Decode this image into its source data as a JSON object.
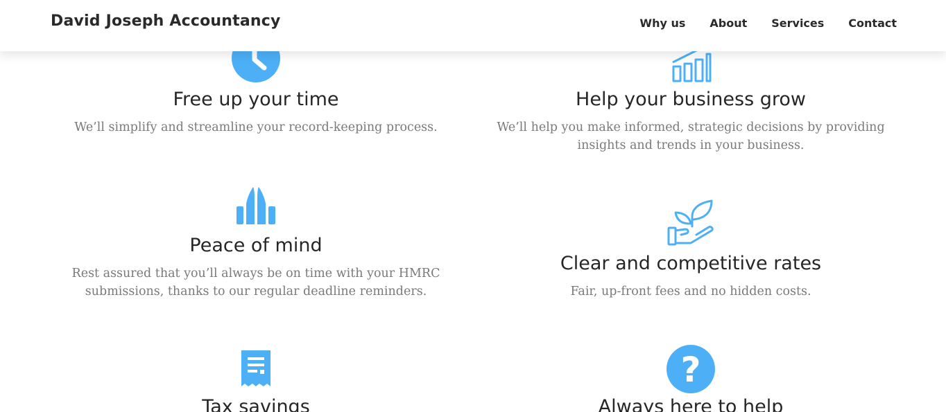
{
  "header": {
    "brand": "David Joseph Accountancy",
    "nav": [
      "Why us",
      "About",
      "Services",
      "Contact"
    ]
  },
  "features": [
    {
      "icon": "clock-icon",
      "title": "Free up your time",
      "text": "We’ll simplify and streamline your record-keeping process."
    },
    {
      "icon": "growth-chart-icon",
      "title": "Help your business grow",
      "text": "We’ll help you make informed, strategic decisions by providing insights and trends in your business."
    },
    {
      "icon": "praying-hands-icon",
      "title": "Peace of mind",
      "text": "Rest assured that you’ll always be on time with your HMRC submissions, thanks to our regular deadline reminders."
    },
    {
      "icon": "seedling-in-hand-icon",
      "title": "Clear and competitive rates",
      "text": "Fair, up-front fees and no hidden costs."
    },
    {
      "icon": "receipt-icon",
      "title": "Tax savings"
    },
    {
      "icon": "question-circle-icon",
      "title": "Always here to help"
    }
  ],
  "colors": {
    "accent": "#4db0f7",
    "heading": "#262626",
    "body_text": "#7a7a7a"
  }
}
